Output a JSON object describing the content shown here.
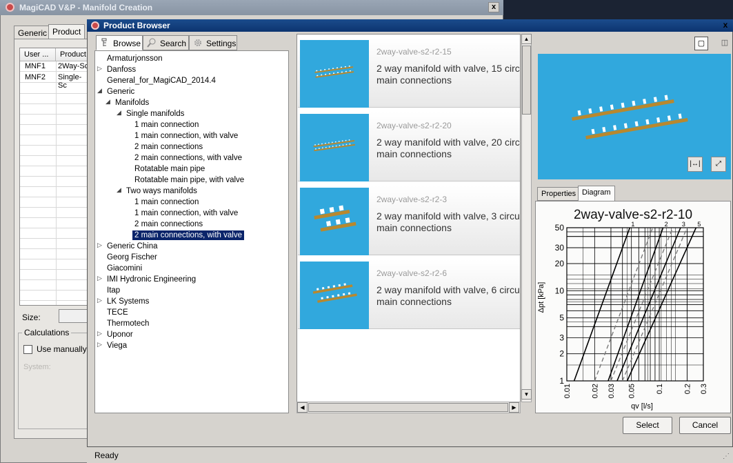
{
  "background_window": {
    "title": "MagiCAD V&P - Manifold Creation",
    "close_label": "x",
    "tabs": [
      {
        "label": "Generic"
      },
      {
        "label": "Product"
      }
    ],
    "table": {
      "headers": [
        "User ...",
        "Product"
      ],
      "rows": [
        {
          "user": "MNF1",
          "product": "2Way-Sc"
        },
        {
          "user": "MNF2",
          "product": "Single-Sc"
        }
      ]
    },
    "size_label": "Size:",
    "calculations_label": "Calculations",
    "use_manually_label": "Use manually g",
    "system_label": "System:"
  },
  "status": {
    "text": "Ready"
  },
  "dialog": {
    "title": "Product Browser",
    "close_label": "x",
    "tabs": [
      {
        "label": "Browse",
        "icon": "browse-icon"
      },
      {
        "label": "Search",
        "icon": "magnifier-icon"
      },
      {
        "label": "Settings",
        "icon": "gear-icon"
      }
    ],
    "tree": [
      {
        "label": "Armaturjonsson"
      },
      {
        "label": "Danfoss"
      },
      {
        "label": "General_for_MagiCAD_2014.4"
      },
      {
        "label": "Generic"
      },
      {
        "label": "Manifolds"
      },
      {
        "label": "Single manifolds"
      },
      {
        "label": "1 main connection"
      },
      {
        "label": "1 main connection, with valve"
      },
      {
        "label": "2 main connections"
      },
      {
        "label": "2 main connections, with valve"
      },
      {
        "label": "Rotatable main pipe"
      },
      {
        "label": "Rotatable main pipe, with valve"
      },
      {
        "label": "Two ways manifolds"
      },
      {
        "label": "1 main connection"
      },
      {
        "label": "1 main connection, with valve"
      },
      {
        "label": "2 main connections"
      },
      {
        "label": "2 main connections, with valve"
      },
      {
        "label": "Generic China"
      },
      {
        "label": "Georg Fischer"
      },
      {
        "label": "Giacomini"
      },
      {
        "label": "IMI Hydronic Engineering"
      },
      {
        "label": "Itap"
      },
      {
        "label": "LK Systems"
      },
      {
        "label": "TECE"
      },
      {
        "label": "Thermotech"
      },
      {
        "label": "Uponor"
      },
      {
        "label": "Viega"
      }
    ],
    "products": [
      {
        "code": "2way-valve-s2-r2-15",
        "desc_line1": "2 way manifold with valve, 15 circ",
        "desc_line2": "main connections"
      },
      {
        "code": "2way-valve-s2-r2-20",
        "desc_line1": "2 way manifold with valve, 20 circ",
        "desc_line2": "main connections"
      },
      {
        "code": "2way-valve-s2-r2-3",
        "desc_line1": "2 way manifold with valve, 3 circu",
        "desc_line2": "main connections"
      },
      {
        "code": "2way-valve-s2-r2-6",
        "desc_line1": "2 way manifold with valve, 6 circu",
        "desc_line2": "main connections"
      }
    ],
    "right_tabs": [
      {
        "label": "Properties"
      },
      {
        "label": "Diagram"
      }
    ],
    "select_label": "Select",
    "cancel_label": "Cancel"
  },
  "chart_data": {
    "type": "line",
    "title": "2way-valve-s2-r2-10",
    "xlabel": "qv [l/s]",
    "ylabel": "Δpt [kPa]",
    "x_scale": "log",
    "y_scale": "log",
    "xlim": [
      0.01,
      0.3
    ],
    "ylim": [
      1,
      50
    ],
    "x_tick_labels": [
      "0.01",
      "0.02",
      "0.03",
      "0.05",
      "0.1",
      "0.2",
      "0.3"
    ],
    "y_tick_labels": [
      "1",
      "2",
      "3",
      "5",
      "10",
      "20",
      "30",
      "50"
    ],
    "grid": true,
    "series": [
      {
        "name": "1",
        "style": "solid",
        "x": [
          0.012,
          0.048
        ],
        "y": [
          1,
          50
        ]
      },
      {
        "name": "2",
        "style": "solid",
        "x": [
          0.028,
          0.11
        ],
        "y": [
          1,
          50
        ]
      },
      {
        "name": "3",
        "style": "solid",
        "x": [
          0.035,
          0.17
        ],
        "y": [
          1,
          50
        ]
      },
      {
        "name": "5",
        "style": "solid",
        "x": [
          0.045,
          0.25
        ],
        "y": [
          1,
          50
        ]
      },
      {
        "style": "dashed",
        "x": [
          0.02,
          0.085
        ],
        "y": [
          1,
          50
        ]
      },
      {
        "style": "dashed",
        "x": [
          0.03,
          0.14
        ],
        "y": [
          1,
          50
        ]
      },
      {
        "style": "dashed",
        "x": [
          0.04,
          0.2
        ],
        "y": [
          1,
          50
        ]
      }
    ]
  }
}
